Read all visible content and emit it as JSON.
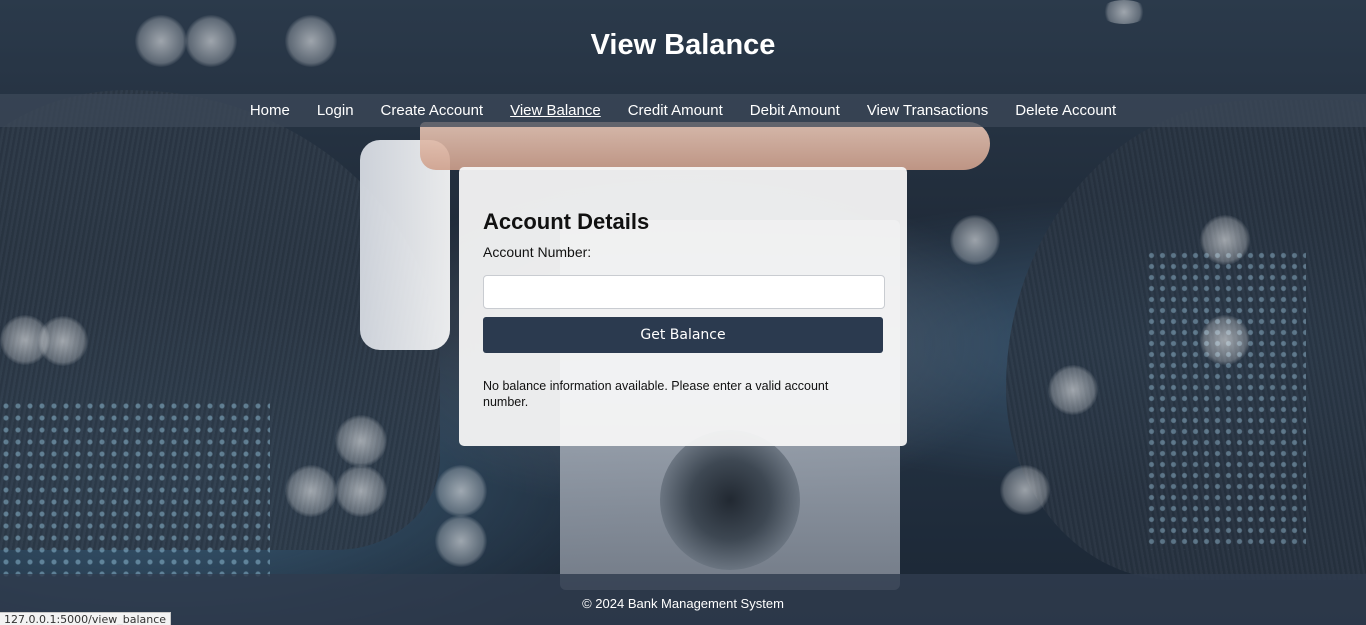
{
  "header": {
    "title": "View Balance"
  },
  "nav": {
    "items": [
      {
        "label": "Home",
        "active": false
      },
      {
        "label": "Login",
        "active": false
      },
      {
        "label": "Create Account",
        "active": false
      },
      {
        "label": "View Balance",
        "active": true
      },
      {
        "label": "Credit Amount",
        "active": false
      },
      {
        "label": "Debit Amount",
        "active": false
      },
      {
        "label": "View Transactions",
        "active": false
      },
      {
        "label": "Delete Account",
        "active": false
      }
    ]
  },
  "card": {
    "title": "Account Details",
    "field_label": "Account Number:",
    "input_value": "",
    "button_label": "Get Balance",
    "message": "No balance information available. Please enter a valid account number."
  },
  "footer": {
    "text": "© 2024 Bank Management System"
  },
  "status_bar": {
    "url": "127.0.0.1:5000/view_balance"
  },
  "colors": {
    "nav_bg": "#3c4858",
    "button_bg": "#2b3a4f",
    "footer_bg": "#303c4e"
  }
}
